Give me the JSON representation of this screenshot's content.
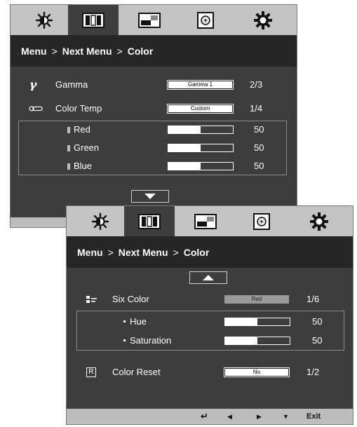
{
  "panel1": {
    "tabs": [
      {
        "icon": "brightness-icon",
        "active": false
      },
      {
        "icon": "picture-icon",
        "active": true
      },
      {
        "icon": "picture-in-picture-icon",
        "active": false
      },
      {
        "icon": "disc-icon",
        "active": false
      },
      {
        "icon": "settings-icon",
        "active": false
      }
    ],
    "breadcrumb": {
      "menu": "Menu",
      "sep1": ">",
      "next": "Next Menu",
      "sep2": ">",
      "current": "Color"
    },
    "gamma": {
      "icon": "gamma-icon",
      "label": "Gamma",
      "value": "Gamma 1",
      "count": "2/3"
    },
    "color_temp": {
      "icon": "color-temp-icon",
      "label": "Color Temp",
      "value": "Custom",
      "count": "1/4"
    },
    "rgb": [
      {
        "label": "Red",
        "value": "50",
        "level": 0.5
      },
      {
        "label": "Green",
        "value": "50",
        "level": 0.5
      },
      {
        "label": "Blue",
        "value": "50",
        "level": 0.5
      }
    ],
    "nav_button": "down-arrow-icon"
  },
  "panel2": {
    "tabs": [
      {
        "icon": "brightness-icon",
        "active": false
      },
      {
        "icon": "picture-icon",
        "active": true
      },
      {
        "icon": "picture-in-picture-icon",
        "active": false
      },
      {
        "icon": "disc-icon",
        "active": false
      },
      {
        "icon": "settings-icon",
        "active": false
      }
    ],
    "breadcrumb": {
      "menu": "Menu",
      "sep1": ">",
      "next": "Next Menu",
      "sep2": ">",
      "current": "Color"
    },
    "nav_button": "up-arrow-icon",
    "six_color": {
      "icon": "six-color-icon",
      "label": "Six Color",
      "value": "Red",
      "count": "1/6"
    },
    "hue_sat": [
      {
        "label": "Hue",
        "value": "50",
        "level": 0.5
      },
      {
        "label": "Saturation",
        "value": "50",
        "level": 0.5
      }
    ],
    "color_reset": {
      "icon_letter": "R",
      "label": "Color Reset",
      "value": "No",
      "count": "1/2"
    },
    "footer": {
      "back": "↵",
      "left": "◀",
      "right": "▶",
      "down": "▼",
      "exit": "Exit"
    }
  },
  "colors": {
    "dark_bg": "#3d3d3d",
    "title_bg": "#262626",
    "tab_bg": "#c3c3c3",
    "active_tab": "#3e3e3e",
    "text": "#ffffff"
  }
}
